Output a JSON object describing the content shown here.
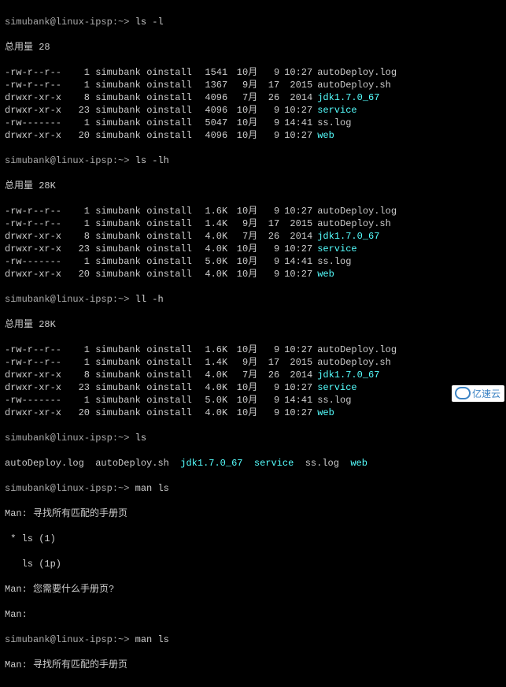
{
  "prompt": "simubank@linux-ipsp:~>",
  "cmd1": "ls -l",
  "total1": "总用量 28",
  "rows1": [
    {
      "perm": "-rw-r--r--",
      "lnk": "1",
      "usr": "simubank",
      "grp": "oinstall",
      "sz": "1541",
      "mon": "10月",
      "day": "9",
      "tm": "10:27",
      "name": "autoDeploy.log",
      "cls": "g"
    },
    {
      "perm": "-rw-r--r--",
      "lnk": "1",
      "usr": "simubank",
      "grp": "oinstall",
      "sz": "1367",
      "mon": "9月",
      "day": "17",
      "tm": "2015",
      "name": "autoDeploy.sh",
      "cls": "g"
    },
    {
      "perm": "drwxr-xr-x",
      "lnk": "8",
      "usr": "simubank",
      "grp": "oinstall",
      "sz": "4096",
      "mon": "7月",
      "day": "26",
      "tm": "2014",
      "name": "jdk1.7.0_67",
      "cls": "cyan"
    },
    {
      "perm": "drwxr-xr-x",
      "lnk": "23",
      "usr": "simubank",
      "grp": "oinstall",
      "sz": "4096",
      "mon": "10月",
      "day": "9",
      "tm": "10:27",
      "name": "service",
      "cls": "cyan"
    },
    {
      "perm": "-rw-------",
      "lnk": "1",
      "usr": "simubank",
      "grp": "oinstall",
      "sz": "5047",
      "mon": "10月",
      "day": "9",
      "tm": "14:41",
      "name": "ss.log",
      "cls": "g"
    },
    {
      "perm": "drwxr-xr-x",
      "lnk": "20",
      "usr": "simubank",
      "grp": "oinstall",
      "sz": "4096",
      "mon": "10月",
      "day": "9",
      "tm": "10:27",
      "name": "web",
      "cls": "cyan"
    }
  ],
  "cmd2": "ls -lh",
  "total2": "总用量 28K",
  "rows2": [
    {
      "perm": "-rw-r--r--",
      "lnk": "1",
      "usr": "simubank",
      "grp": "oinstall",
      "sz": "1.6K",
      "mon": "10月",
      "day": "9",
      "tm": "10:27",
      "name": "autoDeploy.log",
      "cls": "g"
    },
    {
      "perm": "-rw-r--r--",
      "lnk": "1",
      "usr": "simubank",
      "grp": "oinstall",
      "sz": "1.4K",
      "mon": "9月",
      "day": "17",
      "tm": "2015",
      "name": "autoDeploy.sh",
      "cls": "g"
    },
    {
      "perm": "drwxr-xr-x",
      "lnk": "8",
      "usr": "simubank",
      "grp": "oinstall",
      "sz": "4.0K",
      "mon": "7月",
      "day": "26",
      "tm": "2014",
      "name": "jdk1.7.0_67",
      "cls": "cyan"
    },
    {
      "perm": "drwxr-xr-x",
      "lnk": "23",
      "usr": "simubank",
      "grp": "oinstall",
      "sz": "4.0K",
      "mon": "10月",
      "day": "9",
      "tm": "10:27",
      "name": "service",
      "cls": "cyan"
    },
    {
      "perm": "-rw-------",
      "lnk": "1",
      "usr": "simubank",
      "grp": "oinstall",
      "sz": "5.0K",
      "mon": "10月",
      "day": "9",
      "tm": "14:41",
      "name": "ss.log",
      "cls": "g"
    },
    {
      "perm": "drwxr-xr-x",
      "lnk": "20",
      "usr": "simubank",
      "grp": "oinstall",
      "sz": "4.0K",
      "mon": "10月",
      "day": "9",
      "tm": "10:27",
      "name": "web",
      "cls": "cyan"
    }
  ],
  "cmd3": "ll -h",
  "total3": "总用量 28K",
  "rows3": [
    {
      "perm": "-rw-r--r--",
      "lnk": "1",
      "usr": "simubank",
      "grp": "oinstall",
      "sz": "1.6K",
      "mon": "10月",
      "day": "9",
      "tm": "10:27",
      "name": "autoDeploy.log",
      "cls": "g"
    },
    {
      "perm": "-rw-r--r--",
      "lnk": "1",
      "usr": "simubank",
      "grp": "oinstall",
      "sz": "1.4K",
      "mon": "9月",
      "day": "17",
      "tm": "2015",
      "name": "autoDeploy.sh",
      "cls": "g"
    },
    {
      "perm": "drwxr-xr-x",
      "lnk": "8",
      "usr": "simubank",
      "grp": "oinstall",
      "sz": "4.0K",
      "mon": "7月",
      "day": "26",
      "tm": "2014",
      "name": "jdk1.7.0_67",
      "cls": "cyan"
    },
    {
      "perm": "drwxr-xr-x",
      "lnk": "23",
      "usr": "simubank",
      "grp": "oinstall",
      "sz": "4.0K",
      "mon": "10月",
      "day": "9",
      "tm": "10:27",
      "name": "service",
      "cls": "cyan"
    },
    {
      "perm": "-rw-------",
      "lnk": "1",
      "usr": "simubank",
      "grp": "oinstall",
      "sz": "5.0K",
      "mon": "10月",
      "day": "9",
      "tm": "14:41",
      "name": "ss.log",
      "cls": "g"
    },
    {
      "perm": "drwxr-xr-x",
      "lnk": "20",
      "usr": "simubank",
      "grp": "oinstall",
      "sz": "4.0K",
      "mon": "10月",
      "day": "9",
      "tm": "10:27",
      "name": "web",
      "cls": "cyan"
    }
  ],
  "cmd4": "ls",
  "lsline": [
    {
      "name": "autoDeploy.log",
      "cls": "g"
    },
    {
      "name": "autoDeploy.sh",
      "cls": "g"
    },
    {
      "name": "jdk1.7.0_67",
      "cls": "cyan"
    },
    {
      "name": "service",
      "cls": "cyan"
    },
    {
      "name": "ss.log",
      "cls": "g"
    },
    {
      "name": "web",
      "cls": "cyan"
    }
  ],
  "cmd5": "man ls",
  "man1": "Man: 寻找所有匹配的手册页",
  "man_opt1": " * ls (1)",
  "man_opt2": "   ls (1p)",
  "man2": "Man: 您需要什么手册页?",
  "man3": "Man:",
  "cmd6": "man ls",
  "man4": "Man: 寻找所有匹配的手册页",
  "watermark": "亿速云"
}
